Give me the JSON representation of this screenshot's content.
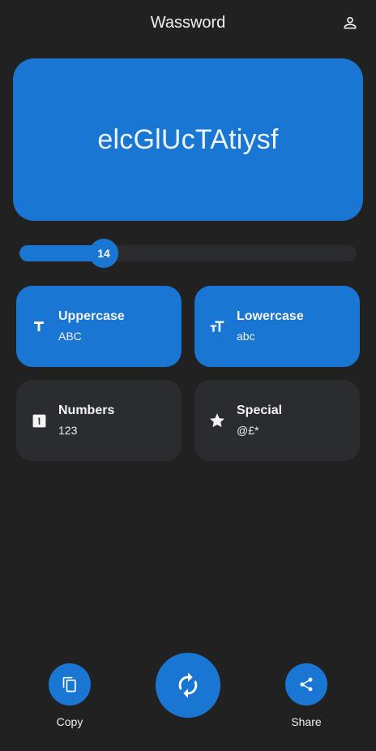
{
  "app": {
    "title": "Wassword",
    "account_icon": "person-outline-icon"
  },
  "password": {
    "value": "elcGlUcTAtiysf"
  },
  "length_slider": {
    "value": 14,
    "fill_fraction": 0.25
  },
  "options": [
    {
      "id": "uppercase",
      "title": "Uppercase",
      "subtitle": "ABC",
      "enabled": true,
      "icon": "text-t-icon"
    },
    {
      "id": "lowercase",
      "title": "Lowercase",
      "subtitle": "abc",
      "enabled": true,
      "icon": "text-size-icon"
    },
    {
      "id": "numbers",
      "title": "Numbers",
      "subtitle": "123",
      "enabled": false,
      "icon": "number-one-box-icon"
    },
    {
      "id": "special",
      "title": "Special",
      "subtitle": "@£*",
      "enabled": false,
      "icon": "star-icon"
    }
  ],
  "actions": {
    "copy_label": "Copy",
    "share_label": "Share",
    "copy_icon": "copy-icon",
    "regenerate_icon": "refresh-icon",
    "share_icon": "share-icon"
  },
  "colors": {
    "background": "#212121",
    "accent": "#1976d2",
    "inactive_tile": "#2b2c30"
  }
}
